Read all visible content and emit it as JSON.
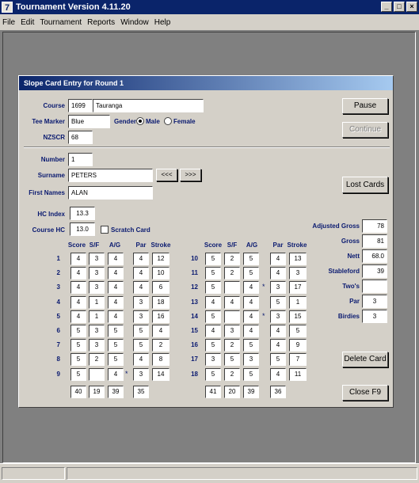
{
  "window": {
    "title": "Tournament Version 4.11.20",
    "icon": "7",
    "min": "_",
    "max": "□",
    "close": "×"
  },
  "menu": [
    "File",
    "Edit",
    "Tournament",
    "Reports",
    "Window",
    "Help"
  ],
  "dialog": {
    "title": "Slope Card Entry for Round 1",
    "course_label": "Course",
    "course_code": "1699",
    "course_name": "Tauranga",
    "tee_label": "Tee Marker",
    "tee_value": "Blue",
    "gender_label": "Gender",
    "male_label": "Male",
    "female_label": "Female",
    "gender_selected": "Male",
    "nzscr_label": "NZSCR",
    "nzscr_value": "68",
    "number_label": "Number",
    "number_value": "1",
    "surname_label": "Surname",
    "surname_value": "PETERS",
    "prev_label": "<<<",
    "next_label": ">>>",
    "firstnames_label": "First Names",
    "firstnames_value": "ALAN",
    "hc_label": "HC Index",
    "hc_value": "13.3",
    "coursehc_label": "Course HC",
    "coursehc_value": "13.0",
    "scratch_label": "Scratch Card",
    "pause_label": "Pause",
    "continue_label": "Continue",
    "lostcards_label": "Lost Cards",
    "delete_label": "Delete Card",
    "close_label": "Close F9"
  },
  "columns": {
    "score": "Score",
    "sf": "S/F",
    "ag": "A/G",
    "par": "Par",
    "stroke": "Stroke"
  },
  "front_nine": [
    {
      "hole": "1",
      "score": "4",
      "sf": "3",
      "ag": "4",
      "star": "",
      "par": "4",
      "stroke": "12"
    },
    {
      "hole": "2",
      "score": "4",
      "sf": "3",
      "ag": "4",
      "star": "",
      "par": "4",
      "stroke": "10"
    },
    {
      "hole": "3",
      "score": "4",
      "sf": "3",
      "ag": "4",
      "star": "",
      "par": "4",
      "stroke": "6"
    },
    {
      "hole": "4",
      "score": "4",
      "sf": "1",
      "ag": "4",
      "star": "",
      "par": "3",
      "stroke": "18"
    },
    {
      "hole": "5",
      "score": "4",
      "sf": "1",
      "ag": "4",
      "star": "",
      "par": "3",
      "stroke": "16"
    },
    {
      "hole": "6",
      "score": "5",
      "sf": "3",
      "ag": "5",
      "star": "",
      "par": "5",
      "stroke": "4"
    },
    {
      "hole": "7",
      "score": "5",
      "sf": "3",
      "ag": "5",
      "star": "",
      "par": "5",
      "stroke": "2"
    },
    {
      "hole": "8",
      "score": "5",
      "sf": "2",
      "ag": "5",
      "star": "",
      "par": "4",
      "stroke": "8"
    },
    {
      "hole": "9",
      "score": "5",
      "sf": "",
      "ag": "4",
      "star": "*",
      "par": "3",
      "stroke": "14"
    }
  ],
  "front_totals": {
    "score": "40",
    "sf": "19",
    "ag": "39",
    "par": "35"
  },
  "back_nine": [
    {
      "hole": "10",
      "score": "5",
      "sf": "2",
      "ag": "5",
      "star": "",
      "par": "4",
      "stroke": "13"
    },
    {
      "hole": "11",
      "score": "5",
      "sf": "2",
      "ag": "5",
      "star": "",
      "par": "4",
      "stroke": "3"
    },
    {
      "hole": "12",
      "score": "5",
      "sf": "",
      "ag": "4",
      "star": "*",
      "par": "3",
      "stroke": "17"
    },
    {
      "hole": "13",
      "score": "4",
      "sf": "4",
      "ag": "4",
      "star": "",
      "par": "5",
      "stroke": "1"
    },
    {
      "hole": "14",
      "score": "5",
      "sf": "",
      "ag": "4",
      "star": "*",
      "par": "3",
      "stroke": "15"
    },
    {
      "hole": "15",
      "score": "4",
      "sf": "3",
      "ag": "4",
      "star": "",
      "par": "4",
      "stroke": "5"
    },
    {
      "hole": "16",
      "score": "5",
      "sf": "2",
      "ag": "5",
      "star": "",
      "par": "4",
      "stroke": "9"
    },
    {
      "hole": "17",
      "score": "3",
      "sf": "5",
      "ag": "3",
      "star": "",
      "par": "5",
      "stroke": "7"
    },
    {
      "hole": "18",
      "score": "5",
      "sf": "2",
      "ag": "5",
      "star": "",
      "par": "4",
      "stroke": "11"
    }
  ],
  "back_totals": {
    "score": "41",
    "sf": "20",
    "ag": "39",
    "par": "36"
  },
  "summary": [
    {
      "label": "Adjusted Gross",
      "value": "78",
      "align": "right"
    },
    {
      "label": "Gross",
      "value": "81",
      "align": "right"
    },
    {
      "label": "Nett",
      "value": "68.0",
      "align": "right"
    },
    {
      "label": "Stableford",
      "value": "39",
      "align": "right"
    },
    {
      "label": "Two's",
      "value": "",
      "align": "right"
    },
    {
      "label": "Par",
      "value": "3",
      "align": "center"
    },
    {
      "label": "Birdies",
      "value": "3",
      "align": "center"
    }
  ]
}
